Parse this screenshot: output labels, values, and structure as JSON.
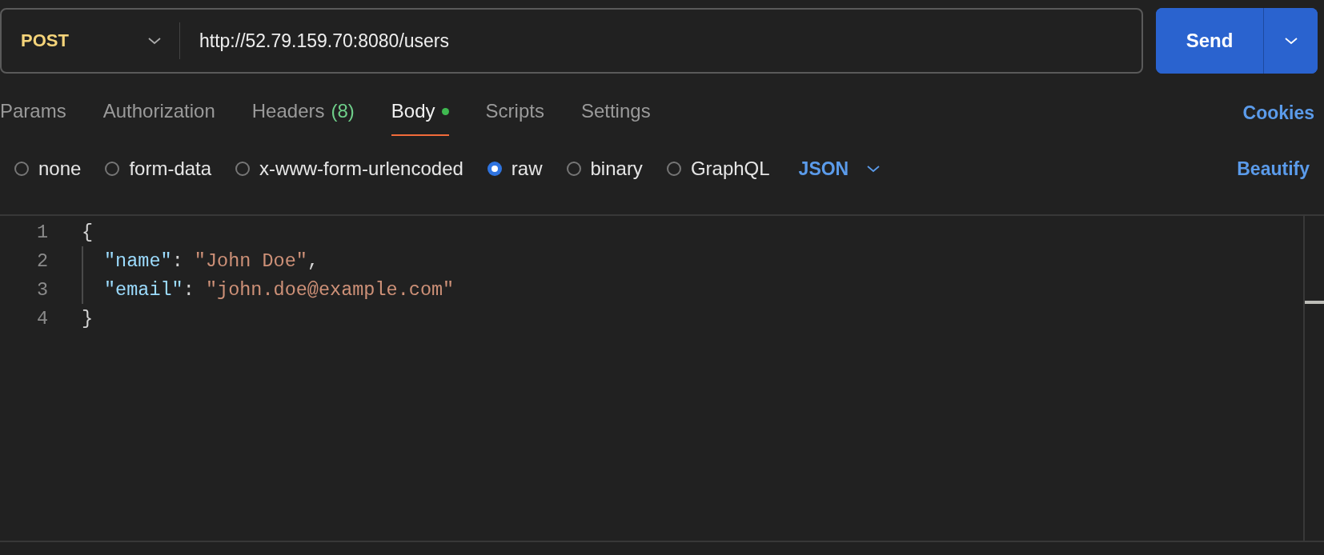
{
  "request": {
    "method": "POST",
    "url": "http://52.79.159.70:8080/users",
    "send_label": "Send"
  },
  "tabs": [
    {
      "label": "Params",
      "modified": false,
      "selected": false
    },
    {
      "label": "Authorization",
      "modified": false,
      "selected": false
    },
    {
      "label": "Headers",
      "count": "(8)",
      "modified": false,
      "selected": false
    },
    {
      "label": "Body",
      "modified": true,
      "selected": true
    },
    {
      "label": "Scripts",
      "modified": false,
      "selected": false
    },
    {
      "label": "Settings",
      "modified": false,
      "selected": false
    }
  ],
  "cookies_link": "Cookies",
  "body_types": [
    {
      "label": "none",
      "selected": false
    },
    {
      "label": "form-data",
      "selected": false
    },
    {
      "label": "x-www-form-urlencoded",
      "selected": false
    },
    {
      "label": "raw",
      "selected": true
    },
    {
      "label": "binary",
      "selected": false
    },
    {
      "label": "GraphQL",
      "selected": false
    }
  ],
  "format": "JSON",
  "beautify_link": "Beautify",
  "editor": {
    "lines": [
      {
        "number": "1",
        "indented": false,
        "tokens": [
          {
            "kind": "punct",
            "text": "{"
          }
        ]
      },
      {
        "number": "2",
        "indented": true,
        "tokens": [
          {
            "kind": "key",
            "text": "\"name\""
          },
          {
            "kind": "punct",
            "text": ": "
          },
          {
            "kind": "string",
            "text": "\"John Doe\""
          },
          {
            "kind": "punct",
            "text": ","
          }
        ]
      },
      {
        "number": "3",
        "indented": true,
        "tokens": [
          {
            "kind": "key",
            "text": "\"email\""
          },
          {
            "kind": "punct",
            "text": ": "
          },
          {
            "kind": "string",
            "text": "\"john.doe@example.com\""
          }
        ]
      },
      {
        "number": "4",
        "indented": false,
        "tokens": [
          {
            "kind": "punct",
            "text": "}"
          }
        ]
      }
    ]
  }
}
